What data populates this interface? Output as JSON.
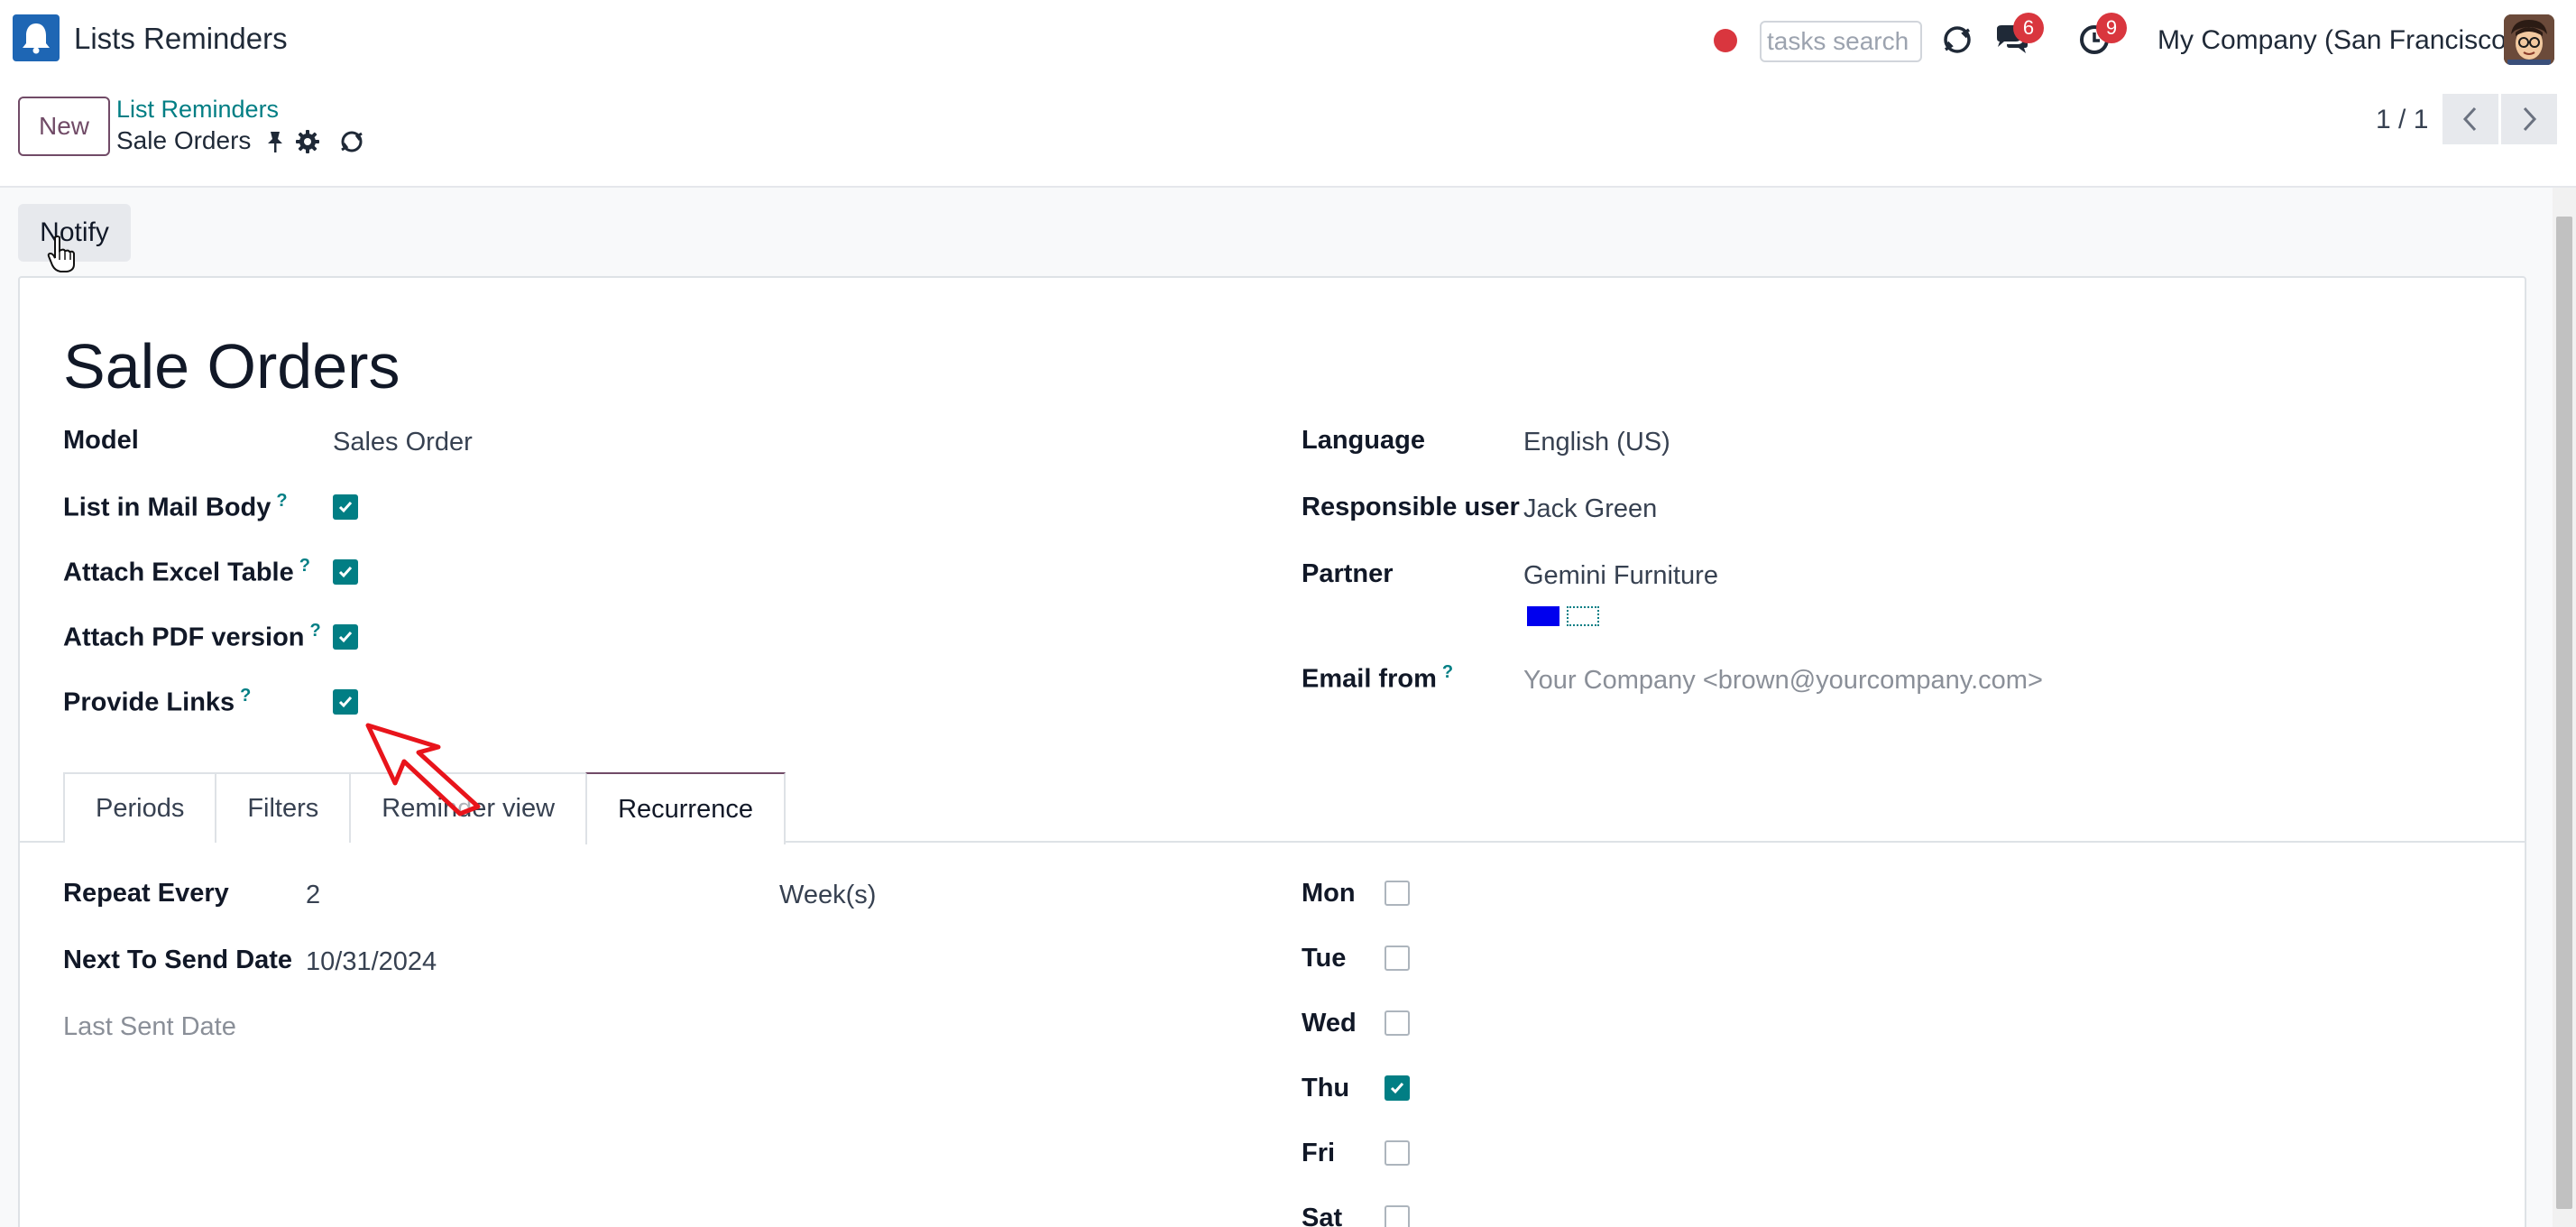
{
  "navbar": {
    "app_title": "Lists Reminders",
    "search_placeholder": "tasks search",
    "messages_count": "6",
    "activities_count": "9",
    "company": "My Company (San Francisco)"
  },
  "control_panel": {
    "new_label": "New",
    "breadcrumb_parent": "List Reminders",
    "breadcrumb_current": "Sale Orders",
    "pager": "1 / 1"
  },
  "form": {
    "notify_label": "Notify",
    "title": "Sale Orders",
    "left": {
      "model_label": "Model",
      "model_value": "Sales Order",
      "list_in_mail_body_label": "List in Mail Body",
      "list_in_mail_body": true,
      "attach_excel_label": "Attach Excel Table",
      "attach_excel": true,
      "attach_pdf_label": "Attach PDF version",
      "attach_pdf": true,
      "provide_links_label": "Provide Links",
      "provide_links": true,
      "help_mark": "?"
    },
    "right": {
      "language_label": "Language",
      "language_value": "English (US)",
      "responsible_label": "Responsible user",
      "responsible_value": "Jack Green",
      "partner_label": "Partner",
      "partner_value": "Gemini Furniture",
      "email_from_label": "Email from",
      "email_from_placeholder": "Your Company <brown@yourcompany.com>"
    },
    "tabs": [
      {
        "label": "Periods",
        "active": false
      },
      {
        "label": "Filters",
        "active": false
      },
      {
        "label": "Reminder view",
        "active": false
      },
      {
        "label": "Recurrence",
        "active": true
      }
    ],
    "recurrence": {
      "repeat_every_label": "Repeat Every",
      "repeat_every_value": "2",
      "repeat_unit": "Week(s)",
      "next_send_label": "Next To Send Date",
      "next_send_value": "10/31/2024",
      "last_sent_label": "Last Sent Date",
      "days": [
        {
          "label": "Mon",
          "checked": false
        },
        {
          "label": "Tue",
          "checked": false
        },
        {
          "label": "Wed",
          "checked": false
        },
        {
          "label": "Thu",
          "checked": true
        },
        {
          "label": "Fri",
          "checked": false
        },
        {
          "label": "Sat",
          "checked": false
        }
      ]
    }
  },
  "colors": {
    "primary": "#714b67",
    "teal": "#017e84",
    "badge": "#d9363e",
    "annotation_arrow": "#e8141b"
  },
  "icons": [
    "bell-icon",
    "record-dot-icon",
    "refresh-icon",
    "chat-icon",
    "clock-icon",
    "pin-icon",
    "gear-icon",
    "chevron-left-icon",
    "chevron-right-icon",
    "check-icon",
    "hand-cursor-icon",
    "arrow-annotation"
  ]
}
